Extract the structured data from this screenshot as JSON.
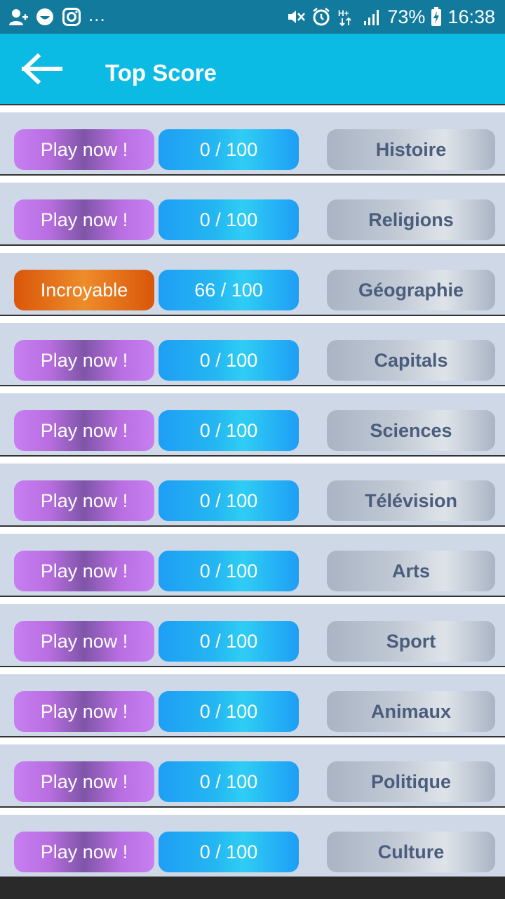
{
  "status_bar": {
    "notification_icons": [
      "add-contact-icon",
      "emoji-icon",
      "instagram-icon"
    ],
    "overflow_text": "...",
    "system_icons": [
      "mute-vibrate-icon",
      "alarm-icon",
      "network-hplus-icon",
      "signal-icon"
    ],
    "battery": "73%",
    "time": "16:38"
  },
  "app_bar": {
    "back_icon": "arrow-left-icon",
    "title": "Top Score"
  },
  "rows": [
    {
      "action": "Play now !",
      "action_type": "play",
      "score": "0 / 100",
      "category": "Histoire"
    },
    {
      "action": "Play now !",
      "action_type": "play",
      "score": "0 / 100",
      "category": "Religions"
    },
    {
      "action": "Incroyable",
      "action_type": "achievement",
      "score": "66 / 100",
      "category": "Géographie"
    },
    {
      "action": "Play now !",
      "action_type": "play",
      "score": "0 / 100",
      "category": "Capitals"
    },
    {
      "action": "Play now !",
      "action_type": "play",
      "score": "0 / 100",
      "category": "Sciences"
    },
    {
      "action": "Play now !",
      "action_type": "play",
      "score": "0 / 100",
      "category": "Télévision"
    },
    {
      "action": "Play now !",
      "action_type": "play",
      "score": "0 / 100",
      "category": "Arts"
    },
    {
      "action": "Play now !",
      "action_type": "play",
      "score": "0 / 100",
      "category": "Sport"
    },
    {
      "action": "Play now !",
      "action_type": "play",
      "score": "0 / 100",
      "category": "Animaux"
    },
    {
      "action": "Play now !",
      "action_type": "play",
      "score": "0 / 100",
      "category": "Politique"
    },
    {
      "action": "Play now !",
      "action_type": "play",
      "score": "0 / 100",
      "category": "Culture"
    }
  ],
  "colors": {
    "status_bar": "#127a9c",
    "app_bar": "#0bbbe4",
    "row_background": "#cfd8e6",
    "play_button": "#b86ee0",
    "achievement_button": "#e07020",
    "score_badge": "#1e9ef5",
    "category_text": "#4a5d7c"
  }
}
